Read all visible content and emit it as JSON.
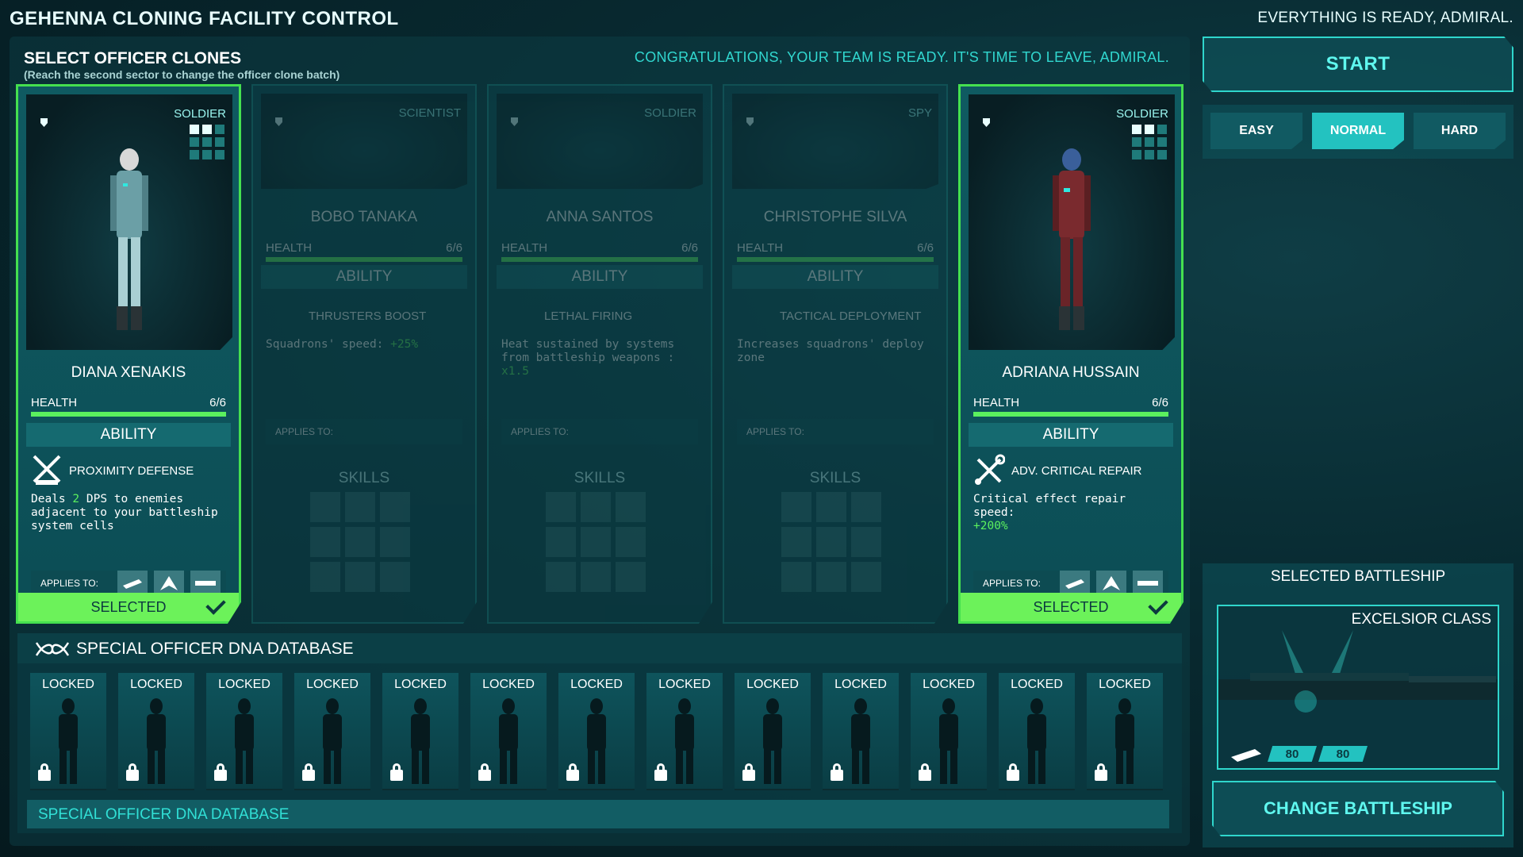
{
  "header": {
    "title": "GEHENNA CLONING FACILITY CONTROL",
    "status": "EVERYTHING IS READY, ADMIRAL."
  },
  "selection": {
    "heading": "SELECT OFFICER CLONES",
    "subheading": "(Reach the second sector to change the officer clone batch)",
    "congrats": "CONGRATULATIONS, YOUR TEAM IS READY. IT'S TIME TO LEAVE, ADMIRAL."
  },
  "officers": [
    {
      "class": "SOLDIER",
      "name": "DIANA XENAKIS",
      "health_label": "HEALTH",
      "health": "6/6",
      "ability_label": "ABILITY",
      "ability_name": "PROXIMITY DEFENSE",
      "desc_a": "Deals ",
      "desc_hl": "2",
      "desc_b": " DPS to enemies adjacent to your battleship system cells",
      "applies_label": "APPLIES TO:",
      "selected_label": "SELECTED"
    },
    {
      "class": "SCIENTIST",
      "name": "BOBO TANAKA",
      "health_label": "HEALTH",
      "health": "6/6",
      "ability_label": "ABILITY",
      "ability_name": "THRUSTERS BOOST",
      "desc_a": "Squadrons' speed: ",
      "desc_hl": "+25%",
      "applies_label": "APPLIES TO:",
      "skills_label": "SKILLS"
    },
    {
      "class": "SOLDIER",
      "name": "ANNA SANTOS",
      "health_label": "HEALTH",
      "health": "6/6",
      "ability_label": "ABILITY",
      "ability_name": "LETHAL FIRING",
      "desc_a": "Heat sustained by systems from battleship weapons : ",
      "desc_hl": "x1.5",
      "applies_label": "APPLIES TO:",
      "skills_label": "SKILLS"
    },
    {
      "class": "SPY",
      "name": "CHRISTOPHE SILVA",
      "health_label": "HEALTH",
      "health": "6/6",
      "ability_label": "ABILITY",
      "ability_name": "TACTICAL DEPLOYMENT",
      "desc_a": "Increases squadrons' deploy zone",
      "applies_label": "APPLIES TO:",
      "skills_label": "SKILLS"
    },
    {
      "class": "SOLDIER",
      "name": "ADRIANA HUSSAIN",
      "health_label": "HEALTH",
      "health": "6/6",
      "ability_label": "ABILITY",
      "ability_name": "ADV. CRITICAL REPAIR",
      "desc_a": "Critical effect repair speed: ",
      "desc_hl": "+200%",
      "applies_label": "APPLIES TO:",
      "selected_label": "SELECTED"
    }
  ],
  "dna": {
    "title": "SPECIAL OFFICER DNA DATABASE",
    "locked_label": "LOCKED",
    "footer": "SPECIAL OFFICER DNA DATABASE"
  },
  "controls": {
    "start": "START",
    "difficulty": [
      "EASY",
      "NORMAL",
      "HARD"
    ],
    "difficulty_selected": "NORMAL"
  },
  "battleship": {
    "title": "SELECTED BATTLESHIP",
    "class": "EXCELSIOR CLASS",
    "stats": [
      "80",
      "80"
    ],
    "change": "CHANGE BATTLESHIP"
  },
  "colors": {
    "accent": "#2fd6cc",
    "selected": "#6cf25a",
    "highlight": "#5bf05e"
  }
}
